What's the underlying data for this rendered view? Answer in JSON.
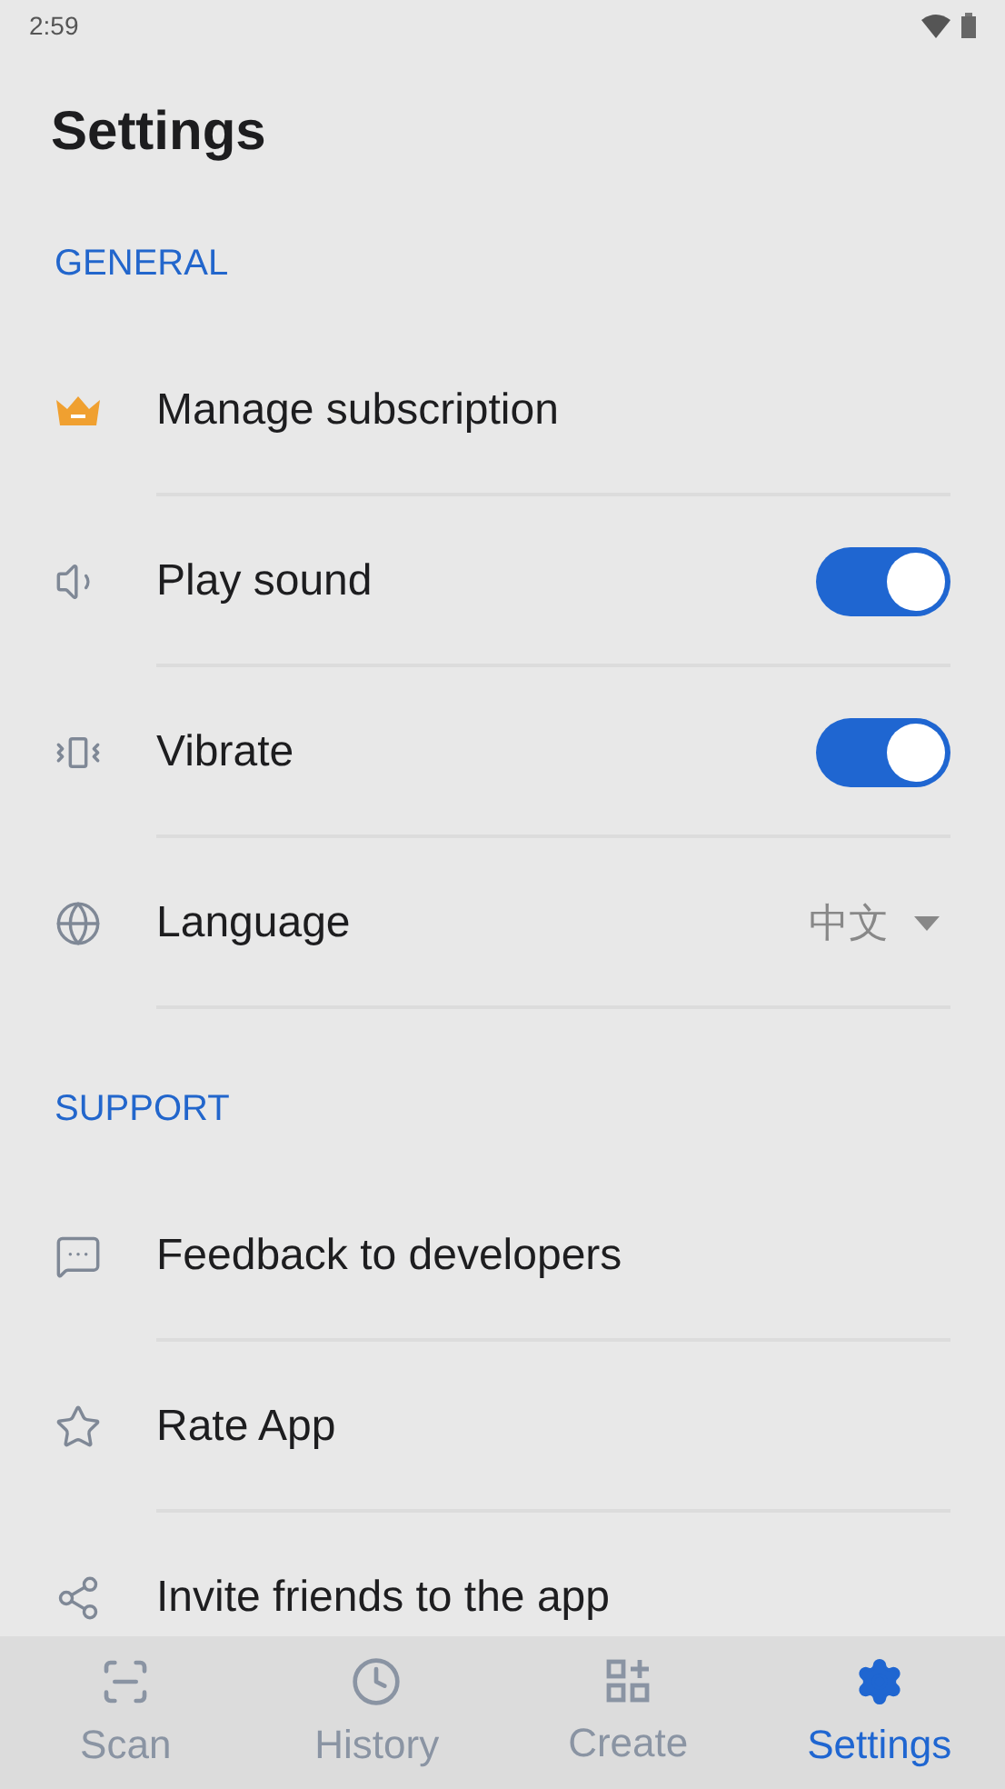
{
  "status_bar": {
    "time": "2:59"
  },
  "title": "Settings",
  "sections": [
    {
      "heading": "GENERAL",
      "items": [
        {
          "kind": "link",
          "label": "Manage subscription"
        },
        {
          "kind": "toggle",
          "label": "Play sound",
          "on": true
        },
        {
          "kind": "toggle",
          "label": "Vibrate",
          "on": true
        },
        {
          "kind": "select",
          "label": "Language",
          "value": "中文"
        }
      ]
    },
    {
      "heading": "SUPPORT",
      "items": [
        {
          "kind": "link",
          "label": "Feedback to developers"
        },
        {
          "kind": "link",
          "label": "Rate App"
        },
        {
          "kind": "link",
          "label": "Invite friends to the app"
        }
      ]
    }
  ],
  "nav": [
    {
      "label": "Scan",
      "selected": false
    },
    {
      "label": "History",
      "selected": false
    },
    {
      "label": "Create",
      "selected": false
    },
    {
      "label": "Settings",
      "selected": true
    }
  ]
}
